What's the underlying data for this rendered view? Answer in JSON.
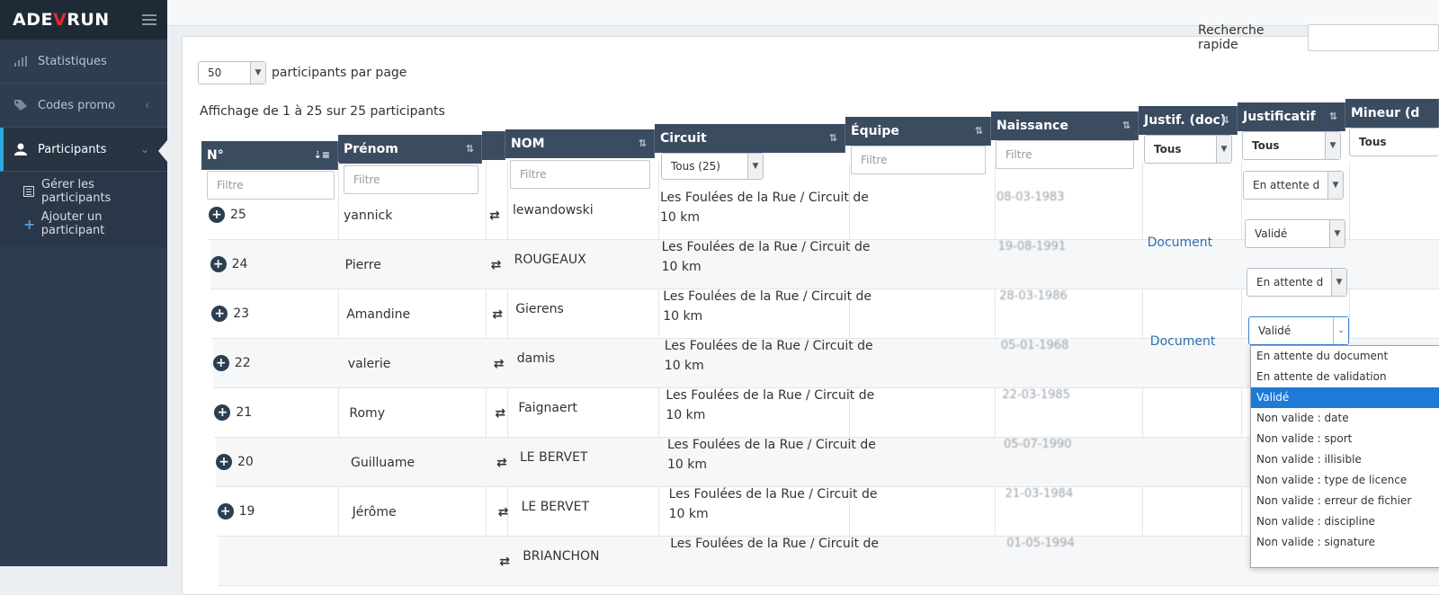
{
  "sidebar": {
    "logo": {
      "left": "ADE",
      "accent": "V",
      "right": "RUN"
    },
    "items": [
      {
        "label": "Statistiques",
        "icon": "bar-chart-icon"
      },
      {
        "label": "Codes promo",
        "icon": "tag-icon"
      },
      {
        "label": "Participants",
        "icon": "user-icon"
      }
    ],
    "subitems": [
      {
        "label": "Gérer les participants",
        "icon": "list-icon"
      },
      {
        "label": "Ajouter un participant",
        "icon": "plus-icon"
      }
    ]
  },
  "search": {
    "label": "Recherche rapide",
    "value": ""
  },
  "perpage": {
    "value": "50",
    "label": "participants par page"
  },
  "info": "Affichage de 1 à 25 sur 25 participants",
  "columns": {
    "num": "N°",
    "prenom": "Prénom",
    "nom": "NOM",
    "circuit": "Circuit",
    "equipe": "Équipe",
    "naissance": "Naissance",
    "justif_doc": "Justif. (doc)",
    "justificatif": "Justificatif",
    "mineur": "Mineur (d"
  },
  "filters": {
    "placeholder": "Filtre",
    "circuit": "Tous (25)",
    "justif_doc": "Tous",
    "justificatif": "Tous",
    "mineur": "Tous",
    "justificatif_row1": "En attente d"
  },
  "rows": [
    {
      "num": "25",
      "prenom": "yannick",
      "nom": "lewandowski",
      "circuit_line1": "Les Foulées de la Rue / Circuit de",
      "circuit_line2": "10 km",
      "naissance": "08-03-1983",
      "doc": "",
      "justificatif": "Validé"
    },
    {
      "num": "24",
      "prenom": "Pierre",
      "nom": "ROUGEAUX",
      "circuit_line1": "Les Foulées de la Rue / Circuit de",
      "circuit_line2": "10 km",
      "naissance": "19-08-1991",
      "doc": "Document",
      "justificatif": "En attente d"
    },
    {
      "num": "23",
      "prenom": "Amandine",
      "nom": "Gierens",
      "circuit_line1": "Les Foulées de la Rue / Circuit de",
      "circuit_line2": "10 km",
      "naissance": "28-03-1986",
      "doc": "",
      "justificatif": "Validé"
    },
    {
      "num": "22",
      "prenom": "valerie",
      "nom": "damis",
      "circuit_line1": "Les Foulées de la Rue / Circuit de",
      "circuit_line2": "10 km",
      "naissance": "05-01-1968",
      "doc": "Document",
      "justificatif": ""
    },
    {
      "num": "21",
      "prenom": "Romy",
      "nom": "Faignaert",
      "circuit_line1": "Les Foulées de la Rue / Circuit de",
      "circuit_line2": "10 km",
      "naissance": "22-03-1985",
      "doc": "",
      "justificatif": ""
    },
    {
      "num": "20",
      "prenom": "Guilluame",
      "nom": "LE BERVET",
      "circuit_line1": "Les Foulées de la Rue / Circuit de",
      "circuit_line2": "10 km",
      "naissance": "05-07-1990",
      "doc": "",
      "justificatif": ""
    },
    {
      "num": "19",
      "prenom": "Jérôme",
      "nom": "LE BERVET",
      "circuit_line1": "Les Foulées de la Rue / Circuit de",
      "circuit_line2": "10 km",
      "naissance": "21-03-1984",
      "doc": "",
      "justificatif": ""
    },
    {
      "num": "",
      "prenom": "",
      "nom": "BRIANCHON",
      "circuit_line1": "Les Foulées de la Rue / Circuit de",
      "circuit_line2": "",
      "naissance": "01-05-1994",
      "doc": "",
      "justificatif": ""
    }
  ],
  "dropdown": {
    "options": [
      "En attente du document",
      "En attente de validation",
      "Validé",
      "Non valide : date",
      "Non valide : sport",
      "Non valide : illisible",
      "Non valide : type de licence",
      "Non valide : erreur de fichier",
      "Non valide : discipline",
      "Non valide : signature"
    ],
    "selected": "Validé"
  },
  "colors": {
    "sidebar": "#2f3d50",
    "header": "#3b4c60",
    "accent": "#1e7ad6",
    "brand_red": "#e02c2c"
  }
}
